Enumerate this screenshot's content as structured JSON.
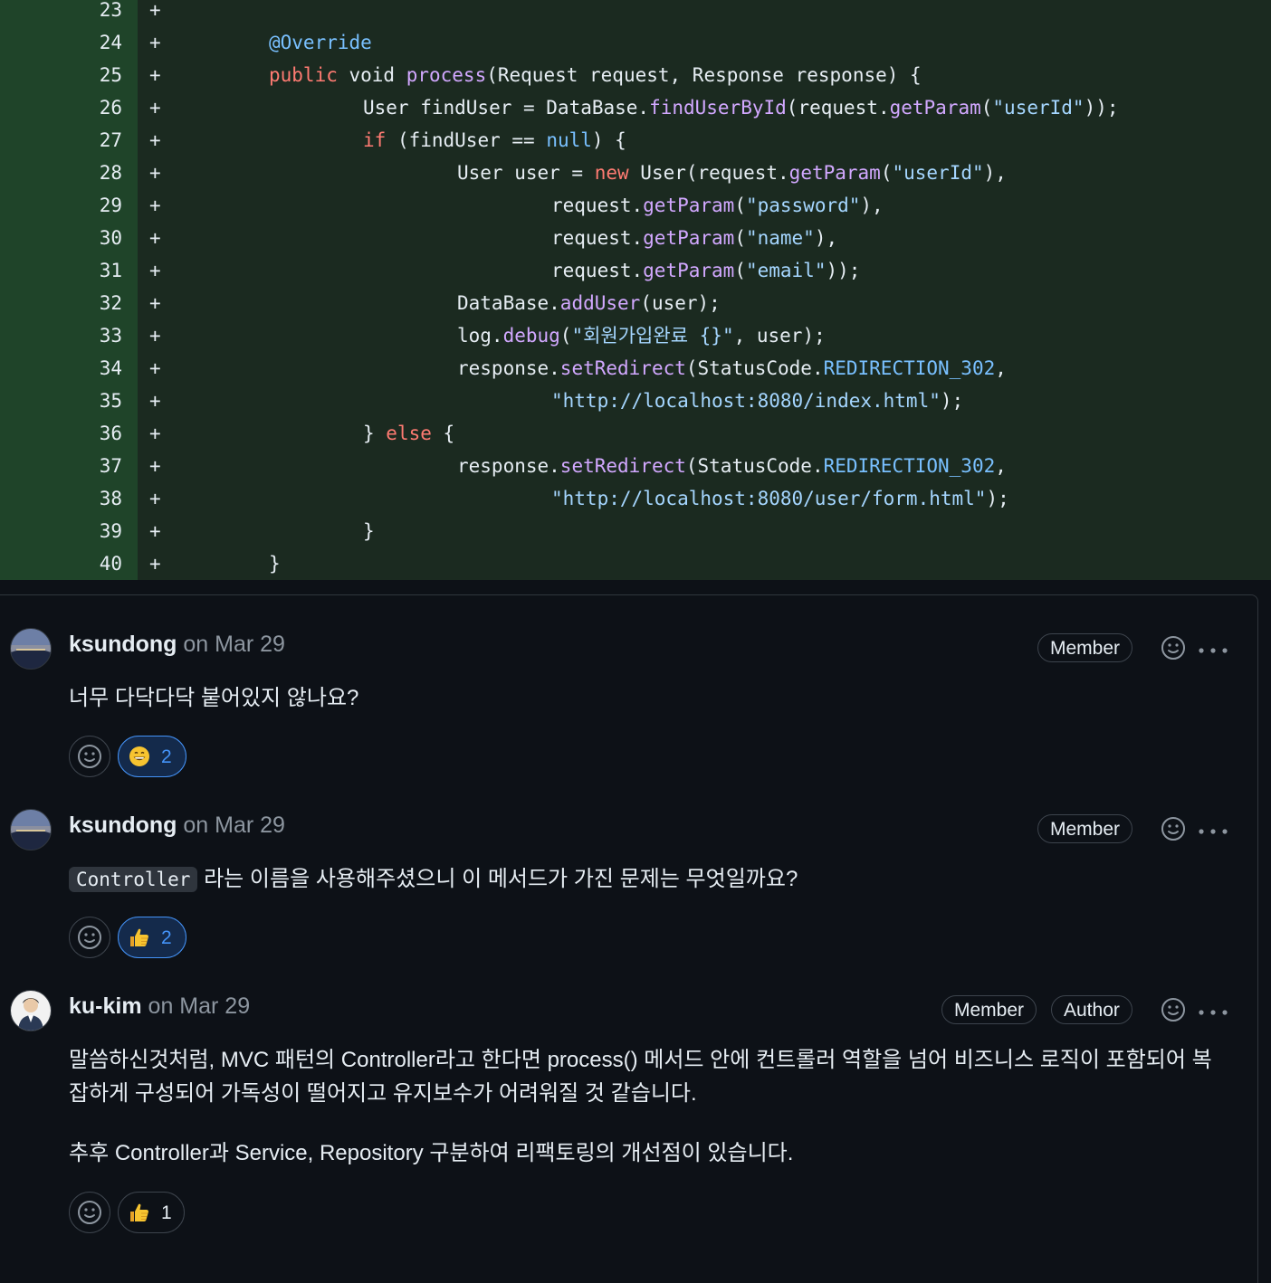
{
  "diff": {
    "lines": [
      {
        "num": "23",
        "sign": "+"
      },
      {
        "num": "24",
        "sign": "+"
      },
      {
        "num": "25",
        "sign": "+"
      },
      {
        "num": "26",
        "sign": "+"
      },
      {
        "num": "27",
        "sign": "+"
      },
      {
        "num": "28",
        "sign": "+"
      },
      {
        "num": "29",
        "sign": "+"
      },
      {
        "num": "30",
        "sign": "+"
      },
      {
        "num": "31",
        "sign": "+"
      },
      {
        "num": "32",
        "sign": "+"
      },
      {
        "num": "33",
        "sign": "+"
      },
      {
        "num": "34",
        "sign": "+"
      },
      {
        "num": "35",
        "sign": "+"
      },
      {
        "num": "36",
        "sign": "+"
      },
      {
        "num": "37",
        "sign": "+"
      },
      {
        "num": "38",
        "sign": "+"
      },
      {
        "num": "39",
        "sign": "+"
      },
      {
        "num": "40",
        "sign": "+"
      }
    ],
    "code": {
      "l24": "@Override",
      "l25": {
        "kw1": "public",
        "t1": " void ",
        "fn1": "process",
        "t2": "(Request request, Response response) {"
      },
      "l26": {
        "t1": "User findUser = DataBase.",
        "fn1": "findUserById",
        "t2": "(request.",
        "fn2": "getParam",
        "t3": "(",
        "s1": "\"userId\"",
        "t4": "));"
      },
      "l27": {
        "kw1": "if",
        "t1": " (findUser == ",
        "c1": "null",
        "t2": ") {"
      },
      "l28": {
        "t1": "User user = ",
        "kw1": "new",
        "t2": " User(request.",
        "fn1": "getParam",
        "t3": "(",
        "s1": "\"userId\"",
        "t4": "),"
      },
      "l29": {
        "t1": "request.",
        "fn1": "getParam",
        "t2": "(",
        "s1": "\"password\"",
        "t3": "),"
      },
      "l30": {
        "t1": "request.",
        "fn1": "getParam",
        "t2": "(",
        "s1": "\"name\"",
        "t3": "),"
      },
      "l31": {
        "t1": "request.",
        "fn1": "getParam",
        "t2": "(",
        "s1": "\"email\"",
        "t3": "));"
      },
      "l32": {
        "t1": "DataBase.",
        "fn1": "addUser",
        "t2": "(user);"
      },
      "l33": {
        "t1": "log.",
        "fn1": "debug",
        "t2": "(",
        "s1": "\"회원가입완료 {}\"",
        "t3": ", user);"
      },
      "l34": {
        "t1": "response.",
        "fn1": "setRedirect",
        "t2": "(StatusCode.",
        "c1": "REDIRECTION_302",
        "t3": ","
      },
      "l35": {
        "s1": "\"http://localhost:8080/index.html\"",
        "t1": ");"
      },
      "l36": {
        "t1": "} ",
        "kw1": "else",
        "t2": " {"
      },
      "l37": {
        "t1": "response.",
        "fn1": "setRedirect",
        "t2": "(StatusCode.",
        "c1": "REDIRECTION_302",
        "t3": ","
      },
      "l38": {
        "s1": "\"http://localhost:8080/user/form.html\"",
        "t1": ");"
      },
      "l39": "}",
      "l40": "}"
    }
  },
  "comments": [
    {
      "author": "ksundong",
      "date": "on Mar 29",
      "badges": [
        "Member"
      ],
      "body": "너무 다닥다닥 붙어있지 않나요?",
      "reaction": {
        "emoji": "grinning-face",
        "count": "2"
      }
    },
    {
      "author": "ksundong",
      "date": "on Mar 29",
      "badges": [
        "Member"
      ],
      "code": "Controller",
      "body": " 라는 이름을 사용해주셨으니 이 메서드가 가진 문제는 무엇일까요?",
      "reaction": {
        "emoji": "thumbs-up",
        "count": "2"
      }
    },
    {
      "author": "ku-kim",
      "date": "on Mar 29",
      "badges": [
        "Member",
        "Author"
      ],
      "body1_line1": "말씀하신것처럼, MVC 패턴의 Controller라고 한다면 process() 메서드 안에 컨트롤러 역할을 넘어 비즈니스 로직이 포함되어 복",
      "body1_line2": "잡하게 구성되어 가독성이 떨어지고 유지보수가 어려워질 것 같습니다.",
      "body2": "추후 Controller과 Service, Repository 구분하여 리팩토링의 개선점이 있습니다.",
      "reaction": {
        "emoji": "thumbs-up",
        "count": "1"
      }
    }
  ],
  "colors": {
    "diff_bg": "#1b2a20",
    "gutter_bg": "#1f4429",
    "page_bg": "#0d1117",
    "keyword": "#ff7b72",
    "function": "#d2a8ff",
    "string": "#a5d6ff",
    "constant": "#79c0ff",
    "reaction_active": "#4493f8"
  },
  "icons": [
    "smiley-icon",
    "kebab-horizontal-icon",
    "grinning-face-emoji",
    "thumbs-up-emoji"
  ]
}
